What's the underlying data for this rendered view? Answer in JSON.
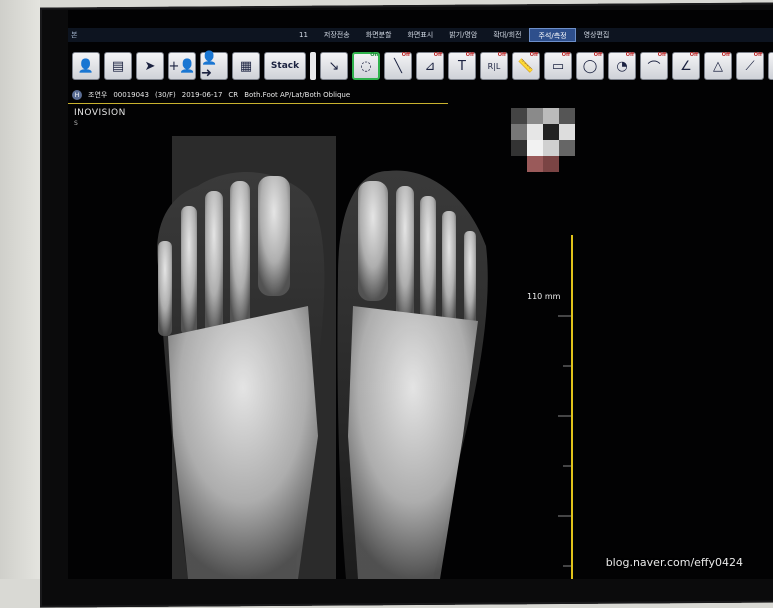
{
  "menu": {
    "left_label": "본",
    "items": [
      "11",
      "저장전송",
      "화면분할",
      "화면표시",
      "밝기/명암",
      "확대/회전",
      "주석/측정",
      "영상편집"
    ],
    "active_index": 6
  },
  "toolbar": {
    "stack_label": "Stack",
    "tools": [
      {
        "name": "person-icon",
        "glyph": "👤"
      },
      {
        "name": "list-icon",
        "glyph": "▤"
      },
      {
        "name": "pointer-icon",
        "glyph": "➤"
      },
      {
        "name": "add-person-icon",
        "glyph": "+👤"
      },
      {
        "name": "person-arrow-icon",
        "glyph": "👤➜"
      },
      {
        "name": "grid-icon",
        "glyph": "▦"
      }
    ],
    "annotation_tools": [
      {
        "name": "arrow-tool-icon",
        "glyph": "↘",
        "state": ""
      },
      {
        "name": "lasso-tool-icon",
        "glyph": "◌",
        "state": "On",
        "green": true
      },
      {
        "name": "line-tool-icon",
        "glyph": "╲",
        "state": "Off"
      },
      {
        "name": "angle-tool-icon",
        "glyph": "⊿",
        "state": "Off"
      },
      {
        "name": "text-tool-icon",
        "glyph": "T",
        "state": "Off"
      },
      {
        "name": "rl-marker-icon",
        "glyph": "R|L",
        "state": "Off"
      },
      {
        "name": "ruler-tool-icon",
        "glyph": "📏",
        "state": "Off"
      },
      {
        "name": "rect-tool-icon",
        "glyph": "▭",
        "state": "Off"
      },
      {
        "name": "ellipse-tool-icon",
        "glyph": "◯",
        "state": "Off"
      },
      {
        "name": "roi-tool-icon",
        "glyph": "◔",
        "state": "Off"
      },
      {
        "name": "curve-tool-icon",
        "glyph": "⌒",
        "state": "Off"
      },
      {
        "name": "cobb-angle-icon",
        "glyph": "∠",
        "state": "Off"
      },
      {
        "name": "triangle-angle-icon",
        "glyph": "△",
        "state": "Off"
      },
      {
        "name": "measure-line-icon",
        "glyph": "⟋",
        "state": "Off"
      },
      {
        "name": "t-square-icon",
        "glyph": "⊤",
        "state": "Off"
      }
    ]
  },
  "patient": {
    "name": "조연우",
    "id": "00019043",
    "age_sex": "(30/F)",
    "date": "2019-06-17",
    "modality": "CR",
    "description": "Both.Foot AP/Lat/Both Oblique"
  },
  "vendor": "INOVISION",
  "vendor_sub": "S",
  "scale_label": "110 mm",
  "watermark": "blog.naver.com/effy0424",
  "colors": {
    "scale": "#e0c21a",
    "active_menu": "#2e4f8c"
  }
}
